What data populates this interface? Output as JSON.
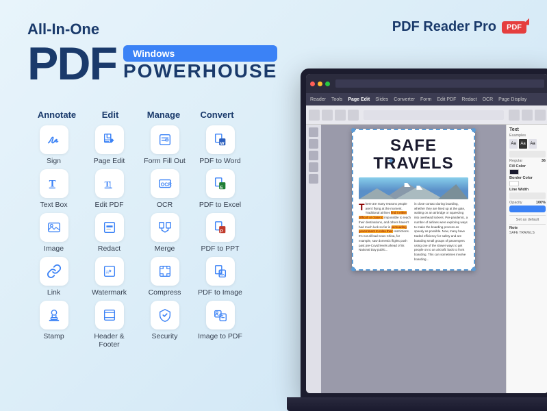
{
  "app": {
    "logo_text": "PDF Reader Pro",
    "logo_badge": "PDF",
    "background_color": "#ddeef8"
  },
  "hero": {
    "all_in_one": "All-In-One",
    "pdf_text": "PDF",
    "windows_badge": "Windows",
    "powerhouse": "POWERHOUSE"
  },
  "categories": [
    {
      "label": "Annotate"
    },
    {
      "label": "Edit"
    },
    {
      "label": "Manage"
    },
    {
      "label": "Convert"
    }
  ],
  "features": [
    {
      "name": "Sign",
      "icon": "sign",
      "col": 0
    },
    {
      "name": "Page Edit",
      "icon": "page-edit",
      "col": 1
    },
    {
      "name": "Form Fill Out",
      "icon": "form",
      "col": 2
    },
    {
      "name": "PDF to Word",
      "icon": "pdf-word",
      "col": 3
    },
    {
      "name": "Text Box",
      "icon": "textbox",
      "col": 0
    },
    {
      "name": "Edit PDF",
      "icon": "edit-pdf",
      "col": 1
    },
    {
      "name": "OCR",
      "icon": "ocr",
      "col": 2
    },
    {
      "name": "PDF to Excel",
      "icon": "pdf-excel",
      "col": 3
    },
    {
      "name": "Image",
      "icon": "image",
      "col": 0
    },
    {
      "name": "Redact",
      "icon": "redact",
      "col": 1
    },
    {
      "name": "Merge",
      "icon": "merge",
      "col": 2
    },
    {
      "name": "PDF to PPT",
      "icon": "pdf-ppt",
      "col": 3
    },
    {
      "name": "Link",
      "icon": "link",
      "col": 0
    },
    {
      "name": "Watermark",
      "icon": "watermark",
      "col": 1
    },
    {
      "name": "Compress",
      "icon": "compress",
      "col": 2
    },
    {
      "name": "PDF to Image",
      "icon": "pdf-image",
      "col": 3
    },
    {
      "name": "Stamp",
      "icon": "stamp",
      "col": 0
    },
    {
      "name": "Header & Footer",
      "icon": "header-footer",
      "col": 1
    },
    {
      "name": "Security",
      "icon": "security",
      "col": 2
    },
    {
      "name": "Image to PDF",
      "icon": "image-to-pdf",
      "col": 3
    }
  ],
  "pdf_app": {
    "page_title_line1": "SAFE",
    "page_title_line2": "TRAVELS",
    "prop_panel_title": "Text",
    "prop_example": "Examples",
    "note_label": "Note",
    "note_value": "SAFE TRAVELS",
    "opacity_label": "Opacity",
    "opacity_value": "100%"
  }
}
